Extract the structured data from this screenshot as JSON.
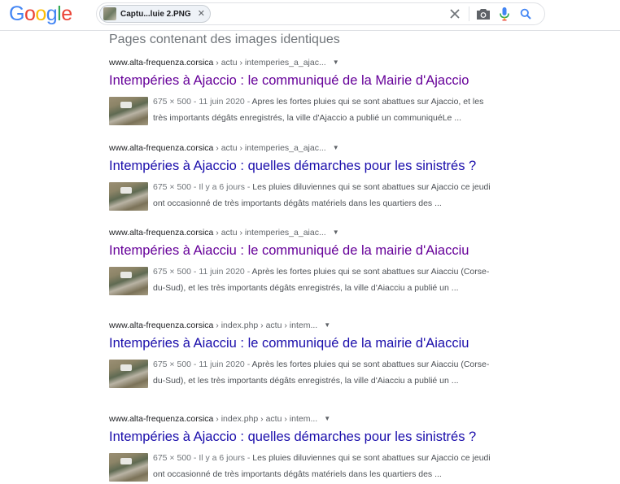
{
  "brand": {
    "logo_letters": [
      "G",
      "o",
      "o",
      "g",
      "l",
      "e"
    ],
    "logo_colors": [
      "#4285f4",
      "#ea4335",
      "#fbbc05",
      "#4285f4",
      "#34a853",
      "#ea4335"
    ]
  },
  "search": {
    "chip_label": "Captu...luie 2.PNG",
    "icons": [
      "close-icon",
      "camera-icon",
      "mic-icon",
      "search-icon"
    ]
  },
  "section_title": "Pages contenant des images identiques",
  "results": [
    {
      "site": "www.alta-frequenza.corsica",
      "path": " › actu › intemperies_a_ajac...",
      "title": "Intempéries à Ajaccio : le communiqué de la Mairie d'Ajaccio",
      "visited": true,
      "meta": "675 × 500 - 11 juin 2020 - ",
      "snippet": "Apres les fortes pluies qui se sont abattues sur Ajaccio, et les très importants dégâts enregistrés, la ville d'Ajaccio a publié un communiquéLe ..."
    },
    {
      "site": "www.alta-frequenza.corsica",
      "path": " › actu › intemperies_a_ajac...",
      "title": "Intempéries à Ajaccio : quelles démarches pour les sinistrés ?",
      "visited": false,
      "meta": "675 × 500 - Il y a 6 jours - ",
      "snippet": "Les pluies diluviennes qui se sont abattues sur Ajaccio ce jeudi ont occasionné de très importants dégâts matériels dans les quartiers des ..."
    },
    {
      "site": "www.alta-frequenza.corsica",
      "path": " › actu › intemperies_a_aiac...",
      "title": "Intempéries à Aiacciu : le communiqué de la mairie d'Aiacciu",
      "visited": true,
      "meta": "675 × 500 - 11 juin 2020 - ",
      "snippet": "Après les fortes pluies qui se sont abattues sur Aiacciu (Corse-du-Sud), et les très importants dégâts enregistrés, la ville d'Aiacciu a publié un ..."
    },
    {
      "site": "www.alta-frequenza.corsica",
      "path": " › index.php › actu › intem...",
      "title": "Intempéries à Aiacciu : le communiqué de la mairie d'Aiacciu",
      "visited": false,
      "meta": "675 × 500 - 11 juin 2020 - ",
      "snippet": "Après les fortes pluies qui se sont abattues sur Aiacciu (Corse-du-Sud), et les très importants dégâts enregistrés, la ville d'Aiacciu a publié un ..."
    },
    {
      "site": "www.alta-frequenza.corsica",
      "path": " › index.php › actu › intem...",
      "title": "Intempéries à Ajaccio : quelles démarches pour les sinistrés ?",
      "visited": false,
      "meta": "675 × 500 - Il y a 6 jours - ",
      "snippet": "Les pluies diluviennes qui se sont abattues sur Ajaccio ce jeudi ont occasionné de très importants dégâts matériels dans les quartiers des ..."
    }
  ]
}
